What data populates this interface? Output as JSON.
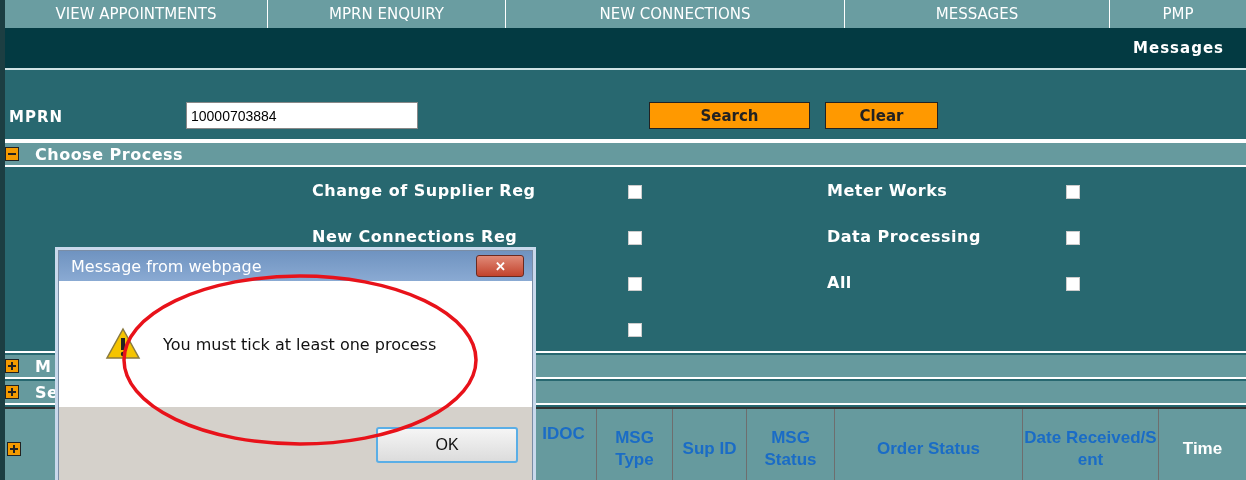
{
  "nav_tabs": [
    {
      "label": "VIEW APPOINTMENTS"
    },
    {
      "label": "MPRN ENQUIRY"
    },
    {
      "label": "NEW CONNECTIONS"
    },
    {
      "label": "MESSAGES"
    },
    {
      "label": "PMP"
    }
  ],
  "page_title": "Messages",
  "search": {
    "label": "MPRN",
    "value": "10000703884",
    "buttons": [
      "Search",
      "Clear"
    ]
  },
  "sections": [
    {
      "title": "Choose Process",
      "expanded": true
    },
    {
      "title": "M",
      "expanded": false
    },
    {
      "title": "Se",
      "expanded": false
    }
  ],
  "processes": [
    {
      "label": "Change of Supplier Reg",
      "checked": false
    },
    {
      "label": "Meter Works",
      "checked": false
    },
    {
      "label": "New Connections Reg",
      "checked": false
    },
    {
      "label": "Data Processing",
      "checked": false
    },
    {
      "checked": false
    },
    {
      "label": "All",
      "checked": false
    },
    {
      "checked": false
    }
  ],
  "table": {
    "columns": [
      {
        "label": "IDOC",
        "active": false
      },
      {
        "label": "MSG Type",
        "active": false
      },
      {
        "label": "Sup ID",
        "active": false
      },
      {
        "label": "MSG Status",
        "active": false
      },
      {
        "label": "Order Status",
        "active": false
      },
      {
        "label": "Date Received/Sent",
        "active": false
      },
      {
        "label": "Time",
        "active": true
      }
    ]
  },
  "dialog": {
    "title": "Message from webpage",
    "close": "✕",
    "message": "You must tick at least one process",
    "button": "OK"
  }
}
